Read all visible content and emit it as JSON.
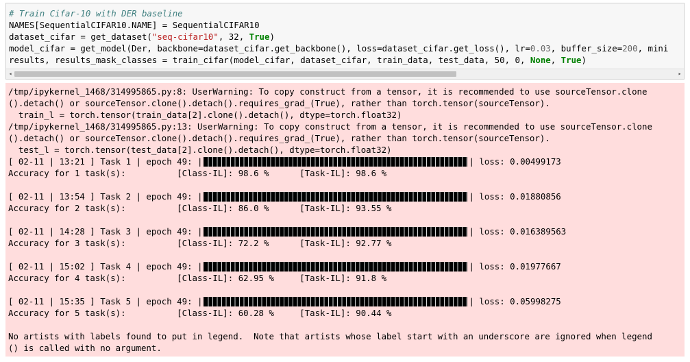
{
  "code": {
    "comment": "# Train Cifar-10 with DER baseline",
    "line2_a": "NAMES[SequentialCIFAR10.NAME] = SequentialCIFAR10",
    "line3_a": "dataset_cifar = get_dataset(",
    "line3_str": "\"seq-cifar10\"",
    "line3_b": ", 32, ",
    "line3_kw": "True",
    "line3_c": ")",
    "line4_a": "model_cifar = get_model(Der, backbone=dataset_cifar.get_backbone(), loss=dataset_cifar.get_loss(), lr=",
    "line4_num1": "0.03",
    "line4_b": ", buffer_size=",
    "line4_num2": "200",
    "line4_c": ", mini",
    "line5_a": "results, results_mask_classes = train_cifar(model_cifar, dataset_cifar, train_data, test_data, 50, 0, ",
    "line5_kw1": "None",
    "line5_b": ", ",
    "line5_kw2": "True",
    "line5_c": ")"
  },
  "scrollbar": {
    "left_arrow": "◂",
    "right_arrow": "▸"
  },
  "colors": {
    "code_bg": "#f7f7f7",
    "stderr_bg": "#ffdddd",
    "comment": "#408080",
    "string": "#ba2121",
    "keyword": "#008000"
  },
  "output": {
    "warn1_l1": "/tmp/ipykernel_1468/314995865.py:8: UserWarning: To copy construct from a tensor, it is recommended to use sourceTensor.clone",
    "warn1_l2": "().detach() or sourceTensor.clone().detach().requires_grad_(True), rather than torch.tensor(sourceTensor).",
    "warn1_l3": "  train_l = torch.tensor(train_data[2].clone().detach(), dtype=torch.float32)",
    "warn2_l1": "/tmp/ipykernel_1468/314995865.py:13: UserWarning: To copy construct from a tensor, it is recommended to use sourceTensor.clone",
    "warn2_l2": "().detach() or sourceTensor.clone().detach().requires_grad_(True), rather than torch.tensor(sourceTensor).",
    "warn2_l3": "  test_l = torch.tensor(test_data[2].clone().detach(), dtype=torch.float32)",
    "tasks": [
      {
        "progress": "[ 02-11 | 13:21 ] Task 1 | epoch 49: |",
        "loss": "| loss: 0.00499173",
        "fill": 1.0,
        "acc": "Accuracy for 1 task(s):          [Class-IL]: 98.6 %      [Task-IL]: 98.6 %"
      },
      {
        "progress": "[ 02-11 | 13:54 ] Task 2 | epoch 49: |",
        "loss": "| loss: 0.01880856",
        "fill": 1.0,
        "acc": "Accuracy for 2 task(s):          [Class-IL]: 86.0 %      [Task-IL]: 93.55 %"
      },
      {
        "progress": "[ 02-11 | 14:28 ] Task 3 | epoch 49: |",
        "loss": "| loss: 0.016389563",
        "fill": 1.0,
        "acc": "Accuracy for 3 task(s):          [Class-IL]: 72.2 %      [Task-IL]: 92.77 %"
      },
      {
        "progress": "[ 02-11 | 15:02 ] Task 4 | epoch 49: |",
        "loss": "| loss: 0.01977667",
        "fill": 1.0,
        "acc": "Accuracy for 4 task(s):          [Class-IL]: 62.95 %     [Task-IL]: 91.8 %"
      },
      {
        "progress": "[ 02-11 | 15:35 ] Task 5 | epoch 49: |",
        "loss": "| loss: 0.05998275",
        "fill": 1.0,
        "acc": "Accuracy for 5 task(s):          [Class-IL]: 60.28 %     [Task-IL]: 90.44 %"
      }
    ],
    "legend_l1": "No artists with labels found to put in legend.  Note that artists whose label start with an underscore are ignored when legend",
    "legend_l2": "() is called with no argument."
  }
}
